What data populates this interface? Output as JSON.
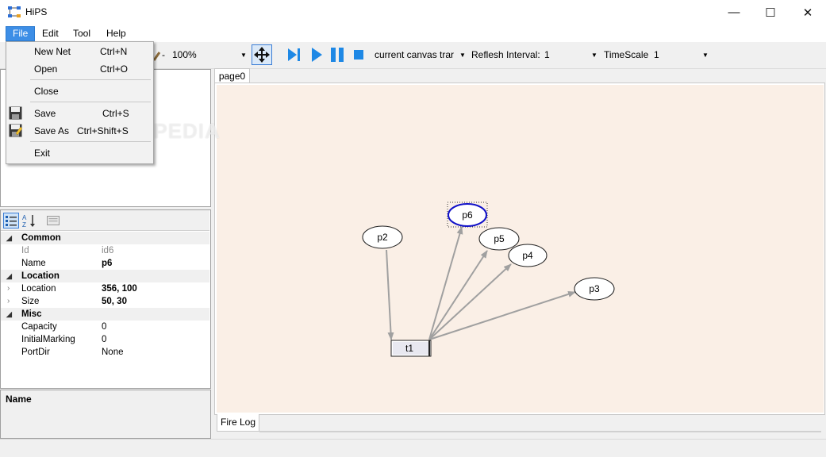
{
  "window": {
    "title": "HiPS",
    "minimize_glyph": "—",
    "maximize_glyph": "☐",
    "close_glyph": "✕"
  },
  "menubar": {
    "items": [
      "File",
      "Edit",
      "Tool",
      "Help"
    ]
  },
  "file_menu": {
    "items": [
      {
        "label": "New Net",
        "shortcut": "Ctrl+N"
      },
      {
        "label": "Open",
        "shortcut": "Ctrl+O"
      },
      {
        "label": "Close",
        "shortcut": ""
      },
      {
        "label": "Save",
        "shortcut": "Ctrl+S",
        "icon": "save-icon"
      },
      {
        "label": "Save As",
        "shortcut": "Ctrl+Shift+S",
        "icon": "save-as-icon"
      },
      {
        "label": "Exit",
        "shortcut": ""
      }
    ]
  },
  "toolbar": {
    "zoom_prefix": "-",
    "zoom": "100%",
    "mode": "current canvas trar",
    "refresh_label": "Reflesh Interval:",
    "refresh_value": "1",
    "timescale_label": "TimeScale",
    "timescale_value": "1",
    "icons": [
      "zoom-icon",
      "move-icon",
      "step-icon",
      "play-icon",
      "pause-icon",
      "stop-icon"
    ]
  },
  "properties": {
    "categories": [
      {
        "name": "Common",
        "rows": [
          {
            "key": "Id",
            "value": "id6"
          },
          {
            "key": "Name",
            "value": "p6"
          }
        ]
      },
      {
        "name": "Location",
        "rows": [
          {
            "key": "Location",
            "value": "356, 100"
          },
          {
            "key": "Size",
            "value": "50, 30"
          }
        ]
      },
      {
        "name": "Misc",
        "rows": [
          {
            "key": "Capacity",
            "value": "0"
          },
          {
            "key": "InitialMarking",
            "value": "0"
          },
          {
            "key": "PortDir",
            "value": "None"
          }
        ]
      }
    ],
    "description_title": "Name"
  },
  "tabs": {
    "page": "page0",
    "log": "Fire Log"
  },
  "net": {
    "places": [
      "p6",
      "p2",
      "p5",
      "p4",
      "p3"
    ],
    "transitions": [
      "t1"
    ],
    "selected": "p6"
  },
  "watermark": "SOFTPEDIA",
  "colors": {
    "canvas_bg": "#faefe6",
    "selection": "#1010c8",
    "arc": "#a0a0a0",
    "accent": "#3d8ee6"
  }
}
